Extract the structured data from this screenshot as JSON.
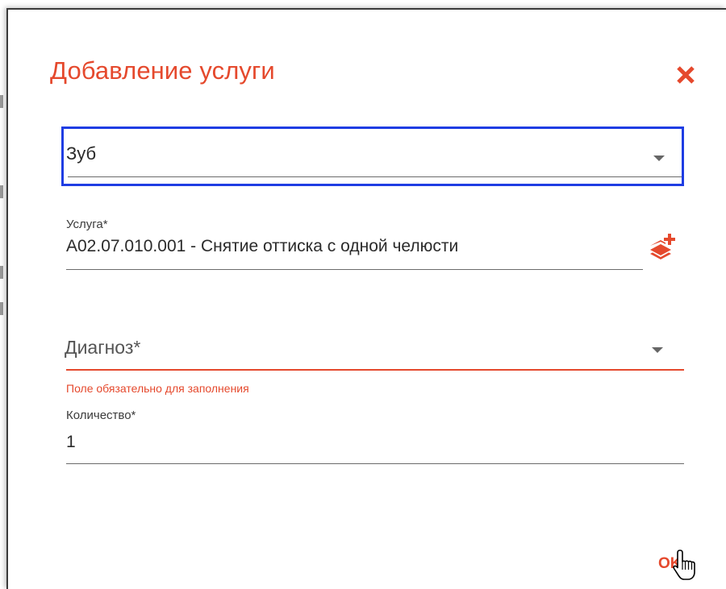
{
  "dialog": {
    "title": "Добавление услуги",
    "close_icon": "close-icon",
    "ok_label": "OK"
  },
  "form": {
    "tooth": {
      "value": "Зуб"
    },
    "service": {
      "label": "Услуга*",
      "value": "A02.07.010.001 - Снятие оттиска с одной челюсти",
      "add_icon": "layers-plus-icon"
    },
    "diagnosis": {
      "placeholder": "Диагноз*",
      "error": "Поле обязательно для заполнения"
    },
    "quantity": {
      "label": "Количество*",
      "value": "1"
    }
  },
  "colors": {
    "accent": "#e5492d",
    "focus_border": "#1f3de3",
    "text": "#2b2b2b"
  }
}
